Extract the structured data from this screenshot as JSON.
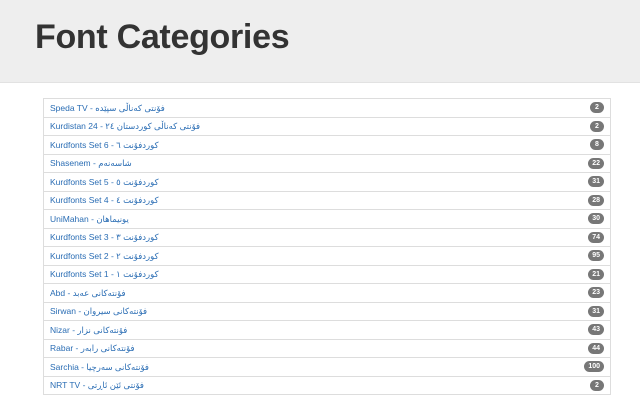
{
  "header": {
    "title": "Font Categories"
  },
  "categories": [
    {
      "label": "Speda TV - فۆنتی کەناڵی سپێدە",
      "count": "2"
    },
    {
      "label": "Kurdistan 24 - فۆنتی کەناڵی کوردستان ٢٤",
      "count": "2"
    },
    {
      "label": "Kurdfonts Set 6 - کوردفۆنت ٦",
      "count": "8"
    },
    {
      "label": "Shasenem - شاسەنەم",
      "count": "22"
    },
    {
      "label": "Kurdfonts Set 5 - کوردفۆنت ٥",
      "count": "31"
    },
    {
      "label": "Kurdfonts Set 4 - کوردفۆنت ٤",
      "count": "28"
    },
    {
      "label": "UniMahan - یونیماهان",
      "count": "30"
    },
    {
      "label": "Kurdfonts Set 3 - کوردفۆنت ٣",
      "count": "74"
    },
    {
      "label": "Kurdfonts Set 2 - کوردفۆنت ٢",
      "count": "95"
    },
    {
      "label": "Kurdfonts Set 1 - کوردفۆنت ١",
      "count": "21"
    },
    {
      "label": "Abd - فۆنتەکانی عەبد",
      "count": "23"
    },
    {
      "label": "Sirwan - فۆنتەکانی سیروان",
      "count": "31"
    },
    {
      "label": "Nizar - فۆنتەکانی نزار",
      "count": "43"
    },
    {
      "label": "Rabar - فۆنتەکانی رابەر",
      "count": "44"
    },
    {
      "label": "Sarchia - فۆنتەکانی سەرچیا",
      "count": "100"
    },
    {
      "label": "NRT TV - فۆنتی ئێن ئاڕتی",
      "count": "2"
    }
  ]
}
